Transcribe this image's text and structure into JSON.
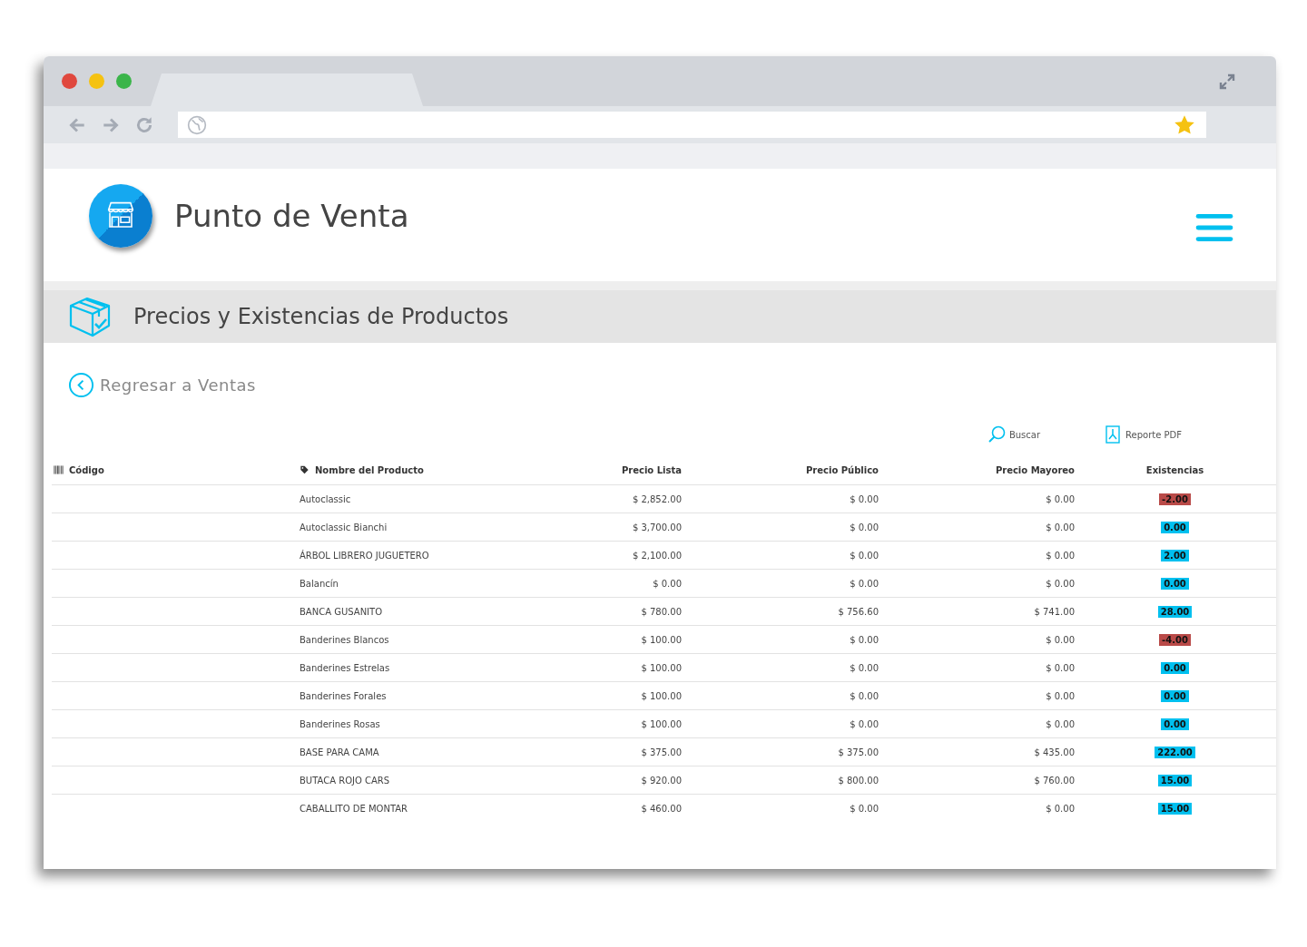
{
  "app": {
    "title": "Punto de Venta"
  },
  "section": {
    "title": "Precios y Existencias de Productos"
  },
  "back_link": "Regresar a Ventas",
  "actions": [
    {
      "kind": "search",
      "label": "Buscar"
    },
    {
      "kind": "pdf",
      "label": "Reporte PDF"
    }
  ],
  "table": {
    "columns": [
      {
        "kind": "barcode",
        "label": "Código"
      },
      {
        "kind": "tag",
        "label": "Nombre del Producto"
      },
      {
        "kind": "plain",
        "label": "Precio Lista"
      },
      {
        "kind": "plain",
        "label": "Precio Público"
      },
      {
        "kind": "plain",
        "label": "Precio Mayoreo"
      },
      {
        "kind": "plain",
        "label": "Existencias"
      }
    ],
    "rows": [
      {
        "name": "Autoclassic",
        "list": "$ 2,852.00",
        "public": "$ 0.00",
        "wholesale": "$ 0.00",
        "stock": "-2.00",
        "color": "#b94a48"
      },
      {
        "name": "Autoclassic Bianchi",
        "list": "$ 3,700.00",
        "public": "$ 0.00",
        "wholesale": "$ 0.00",
        "stock": "0.00",
        "color": "#00c0ef"
      },
      {
        "name": "ÁRBOL LIBRERO JUGUETERO",
        "list": "$ 2,100.00",
        "public": "$ 0.00",
        "wholesale": "$ 0.00",
        "stock": "2.00",
        "color": "#00c0ef"
      },
      {
        "name": "Balancín",
        "list": "$ 0.00",
        "public": "$ 0.00",
        "wholesale": "$ 0.00",
        "stock": "0.00",
        "color": "#00c0ef"
      },
      {
        "name": "BANCA GUSANITO",
        "list": "$ 780.00",
        "public": "$ 756.60",
        "wholesale": "$ 741.00",
        "stock": "28.00",
        "color": "#00c0ef"
      },
      {
        "name": "Banderines Blancos",
        "list": "$ 100.00",
        "public": "$ 0.00",
        "wholesale": "$ 0.00",
        "stock": "-4.00",
        "color": "#b94a48"
      },
      {
        "name": "Banderines Estrelas",
        "list": "$ 100.00",
        "public": "$ 0.00",
        "wholesale": "$ 0.00",
        "stock": "0.00",
        "color": "#00c0ef"
      },
      {
        "name": "Banderines Forales",
        "list": "$ 100.00",
        "public": "$ 0.00",
        "wholesale": "$ 0.00",
        "stock": "0.00",
        "color": "#00c0ef"
      },
      {
        "name": "Banderines Rosas",
        "list": "$ 100.00",
        "public": "$ 0.00",
        "wholesale": "$ 0.00",
        "stock": "0.00",
        "color": "#00c0ef"
      },
      {
        "name": "BASE PARA CAMA",
        "list": "$ 375.00",
        "public": "$ 375.00",
        "wholesale": "$ 435.00",
        "stock": "222.00",
        "color": "#00c0ef"
      },
      {
        "name": "BUTACA ROJO CARS",
        "list": "$ 920.00",
        "public": "$ 800.00",
        "wholesale": "$ 760.00",
        "stock": "15.00",
        "color": "#00c0ef"
      },
      {
        "name": "CABALLITO DE MONTAR",
        "list": "$ 460.00",
        "public": "$ 0.00",
        "wholesale": "$ 0.00",
        "stock": "15.00",
        "color": "#00c0ef"
      }
    ]
  }
}
